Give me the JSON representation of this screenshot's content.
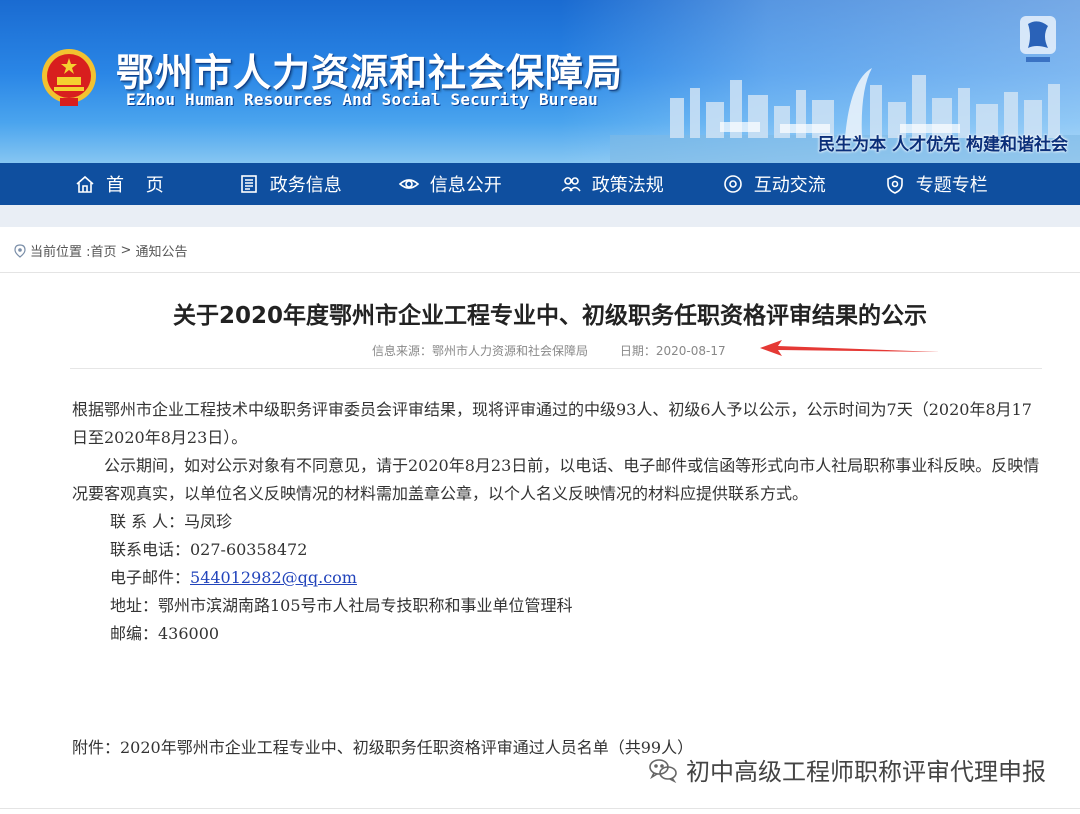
{
  "header": {
    "title_cn": "鄂州市人力资源和社会保障局",
    "title_en": "EZhou Human Resources And Social Security Bureau",
    "slogan": "民生为本 人才优先 构建和谐社会",
    "badge_icon": "ezhou-city-logo-icon",
    "emblem_icon": "national-emblem-icon"
  },
  "nav": {
    "items": [
      {
        "label": "首 页",
        "icon": "home-icon"
      },
      {
        "label": "政务信息",
        "icon": "document-icon"
      },
      {
        "label": "信息公开",
        "icon": "eye-icon"
      },
      {
        "label": "政策法规",
        "icon": "people-icon"
      },
      {
        "label": "互动交流",
        "icon": "chat-icon"
      },
      {
        "label": "专题专栏",
        "icon": "shield-icon"
      }
    ]
  },
  "breadcrumb": {
    "prefix": "当前位置 :",
    "home": "首页",
    "separator": ">",
    "current": "通知公告"
  },
  "article": {
    "title": "关于2020年度鄂州市企业工程专业中、初级职务任职资格评审结果的公示",
    "source": "信息来源：鄂州市人力资源和社会保障局",
    "date": "日期：2020-08-17",
    "paragraphs": [
      "根据鄂州市企业工程技术中级职务评审委员会评审结果，现将评审通过的中级93人、初级6人予以公示，公示时间为7天（2020年8月17日至2020年8月23日）。",
      "公示期间，如对公示对象有不同意见，请于2020年8月23日前，以电话、电子邮件或信函等形式向市人社局职称事业科反映。反映情况要客观真实，以单位名义反映情况的材料需加盖章公章，以个人名义反映情况的材料应提供联系方式。"
    ],
    "contact": {
      "person": "联 系 人：马凤珍",
      "phone": "联系电话：027-60358472",
      "email_label": "电子邮件：",
      "email": "544012982@qq.com",
      "address": "地址：鄂州市滨湖南路105号市人社局专技职称和事业单位管理科",
      "postcode": "邮编：436000"
    },
    "attachment": "附件：2020年鄂州市企业工程专业中、初级职务任职资格评审通过人员名单（共99人）"
  },
  "watermark": {
    "text": "初中高级工程师职称评审代理申报",
    "icon": "wechat-icon"
  },
  "colors": {
    "header_blue": "#1a6bd1",
    "nav_blue": "#0f4f9f",
    "annotation_arrow": "#e53935",
    "link": "#2244bb"
  }
}
